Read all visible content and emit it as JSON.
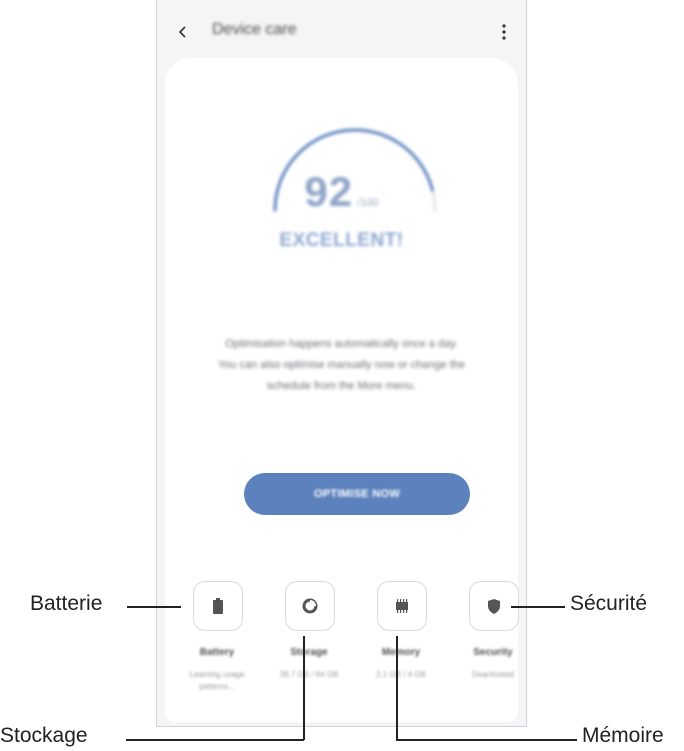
{
  "app": {
    "title": "Device care",
    "back_icon": "chevron-left-icon",
    "more_icon": "more-vert-icon"
  },
  "score": {
    "value": "92",
    "out_of": "/100",
    "status": "EXCELLENT!",
    "gauge_fraction": 0.92,
    "color": "#5c82be"
  },
  "description": {
    "line1": "Optimisation happens automatically once a day.",
    "line2": "You can also optimise manually now or change the",
    "line3": "schedule from the More menu."
  },
  "optimise_button": {
    "label": "OPTIMISE NOW",
    "color": "#5c82be"
  },
  "tiles": [
    {
      "icon": "battery-icon",
      "label": "Battery",
      "sub": "Learning usage patterns..."
    },
    {
      "icon": "storage-icon",
      "label": "Storage",
      "sub": "38.7 GB / 64 GB"
    },
    {
      "icon": "memory-icon",
      "label": "Memory",
      "sub": "2.1 GB / 4 GB"
    },
    {
      "icon": "security-icon",
      "label": "Security",
      "sub": "Deactivated"
    }
  ],
  "callouts": {
    "battery": "Batterie",
    "storage": "Stockage",
    "memory": "Mémoire",
    "security": "Sécurité"
  }
}
